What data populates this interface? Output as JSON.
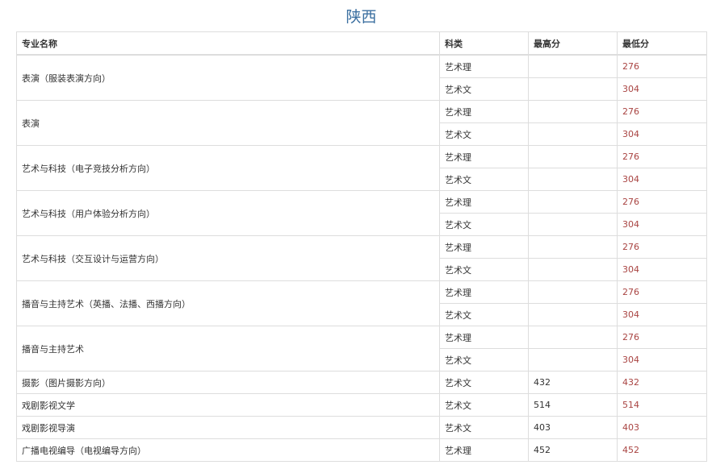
{
  "title": "陕西",
  "headers": [
    "专业名称",
    "科类",
    "最高分",
    "最低分"
  ],
  "rows": [
    {
      "name": "表演（服装表演方向）",
      "entries": [
        {
          "type": "艺术理",
          "max": "",
          "min": "276"
        },
        {
          "type": "艺术文",
          "max": "",
          "min": "304"
        }
      ]
    },
    {
      "name": "表演",
      "entries": [
        {
          "type": "艺术理",
          "max": "",
          "min": "276"
        },
        {
          "type": "艺术文",
          "max": "",
          "min": "304"
        }
      ]
    },
    {
      "name": "艺术与科技（电子竞技分析方向）",
      "entries": [
        {
          "type": "艺术理",
          "max": "",
          "min": "276"
        },
        {
          "type": "艺术文",
          "max": "",
          "min": "304"
        }
      ]
    },
    {
      "name": "艺术与科技（用户体验分析方向）",
      "entries": [
        {
          "type": "艺术理",
          "max": "",
          "min": "276"
        },
        {
          "type": "艺术文",
          "max": "",
          "min": "304"
        }
      ]
    },
    {
      "name": "艺术与科技（交互设计与运营方向）",
      "entries": [
        {
          "type": "艺术理",
          "max": "",
          "min": "276"
        },
        {
          "type": "艺术文",
          "max": "",
          "min": "304"
        }
      ]
    },
    {
      "name": "播音与主持艺术（英播、法播、西播方向）",
      "entries": [
        {
          "type": "艺术理",
          "max": "",
          "min": "276"
        },
        {
          "type": "艺术文",
          "max": "",
          "min": "304"
        }
      ]
    },
    {
      "name": "播音与主持艺术",
      "entries": [
        {
          "type": "艺术理",
          "max": "",
          "min": "276"
        },
        {
          "type": "艺术文",
          "max": "",
          "min": "304"
        }
      ]
    },
    {
      "name": "摄影（图片摄影方向）",
      "entries": [
        {
          "type": "艺术文",
          "max": "432",
          "min": "432"
        }
      ]
    },
    {
      "name": "戏剧影视文学",
      "entries": [
        {
          "type": "艺术文",
          "max": "514",
          "min": "514"
        }
      ]
    },
    {
      "name": "戏剧影视导演",
      "entries": [
        {
          "type": "艺术文",
          "max": "403",
          "min": "403"
        }
      ]
    },
    {
      "name": "广播电视编导（电视编导方向）",
      "entries": [
        {
          "type": "艺术理",
          "max": "452",
          "min": "452"
        }
      ]
    }
  ],
  "colors": {
    "title": "#3b6fa0",
    "min_score": "#a94442",
    "border": "#dddddd"
  }
}
